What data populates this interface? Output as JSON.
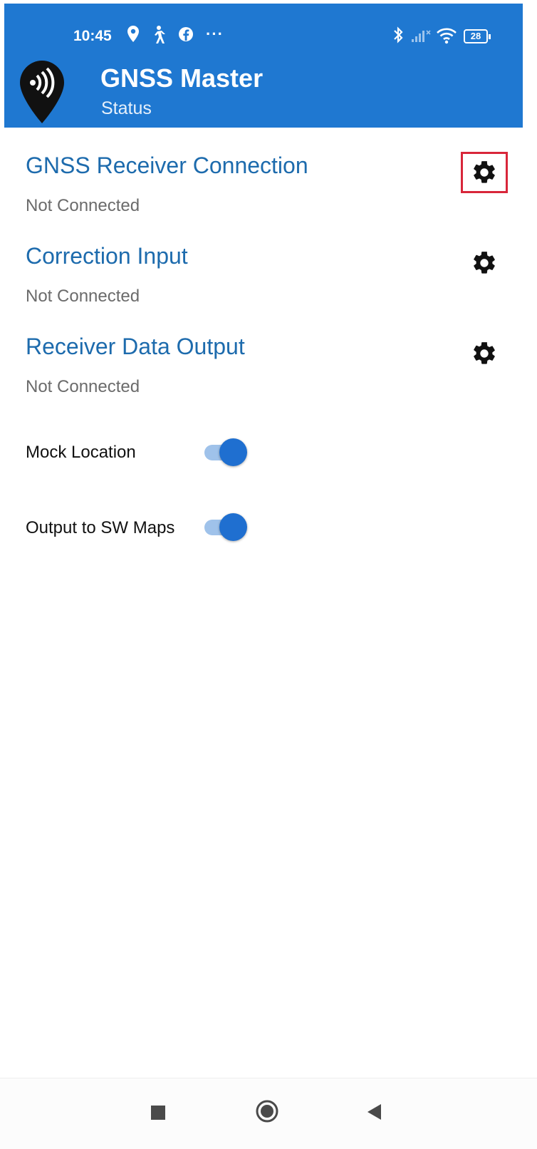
{
  "status_bar": {
    "time": "10:45",
    "overflow": "···",
    "battery": "28",
    "icons": [
      "location-pin-icon",
      "walking-icon",
      "facebook-icon",
      "bluetooth-icon",
      "signal-icon",
      "wifi-icon",
      "battery-icon"
    ]
  },
  "app_bar": {
    "title": "GNSS Master",
    "subtitle": "Status",
    "logo": "gnss-pin-logo"
  },
  "sections": [
    {
      "title": "GNSS Receiver Connection",
      "status": "Not Connected",
      "icon": "gear-icon"
    },
    {
      "title": "Correction Input",
      "status": "Not Connected",
      "icon": "gear-icon"
    },
    {
      "title": "Receiver Data Output",
      "status": "Not Connected",
      "icon": "gear-icon"
    }
  ],
  "toggles": [
    {
      "label": "Mock Location",
      "on": true
    },
    {
      "label": "Output to SW Maps",
      "on": true
    }
  ],
  "colors": {
    "primary": "#1f78d1",
    "section_title": "#1d6bad",
    "highlight": "#d8263a",
    "toggle_knob": "#1f6fd0",
    "toggle_track": "#9fc2ea"
  },
  "nav_bar": {
    "buttons": [
      "recents-icon",
      "home-icon",
      "back-icon"
    ]
  }
}
